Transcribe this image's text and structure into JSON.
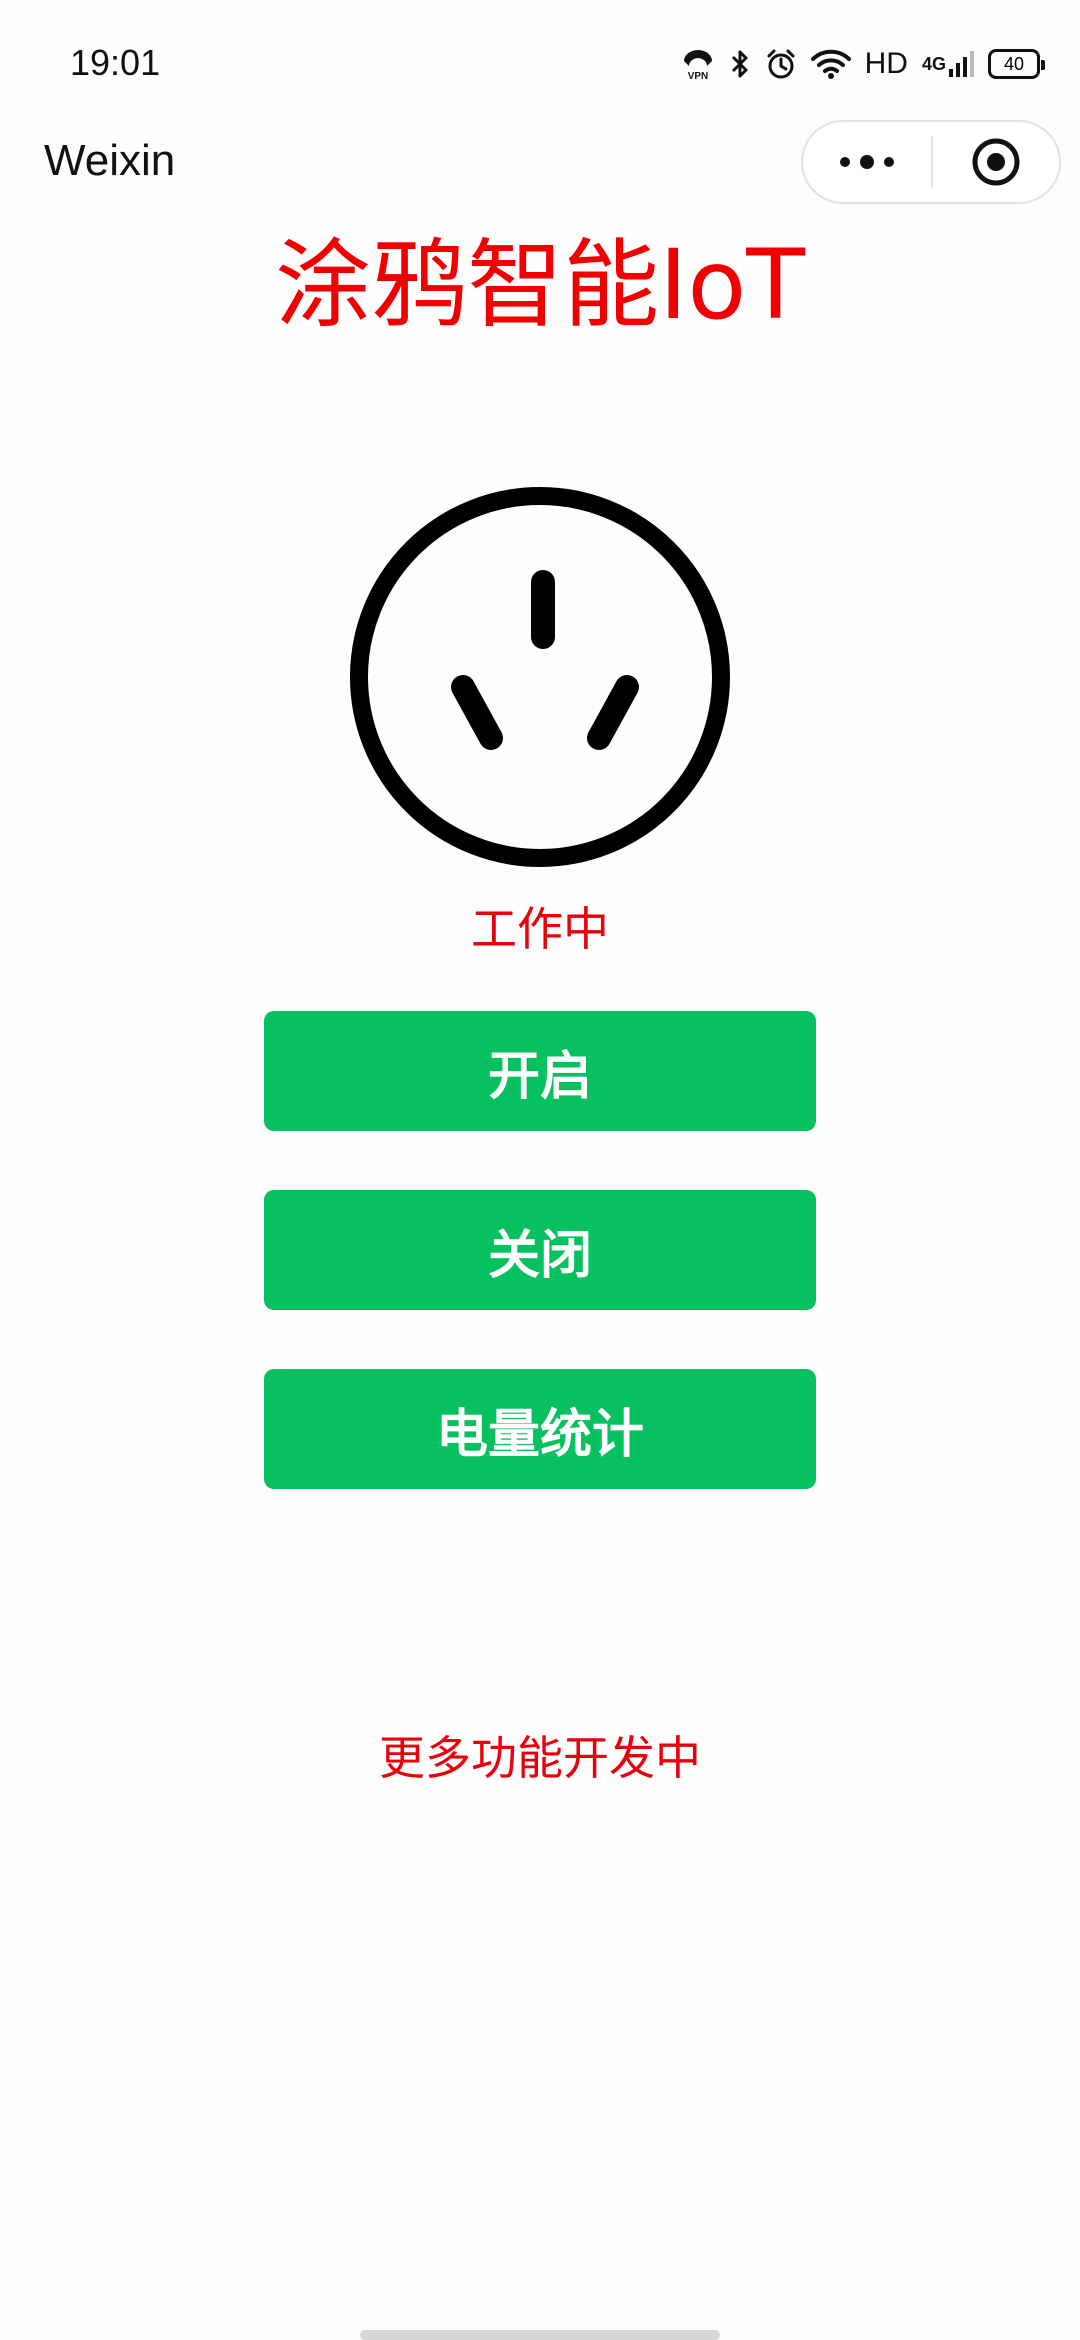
{
  "status_bar": {
    "time": "19:01",
    "icons": [
      "vpn-icon",
      "bluetooth-icon",
      "alarm-icon",
      "wifi-icon",
      "hd-label",
      "signal-4g-icon",
      "battery-icon"
    ],
    "hd_label": "HD",
    "network_label": "4G",
    "battery_level": "40"
  },
  "title_bar": {
    "app_title": "Weixin",
    "menu_icon": "more-dots-icon",
    "close_icon": "target-icon"
  },
  "main": {
    "title": "涂鸦智能IoT",
    "device_icon": "power-socket-icon",
    "status": "工作中",
    "buttons": {
      "open": "开启",
      "close": "关闭",
      "power_stats": "电量统计"
    },
    "footer_note": "更多功能开发中"
  },
  "colors": {
    "accent_red": "#e8000b",
    "button_green": "#07c160",
    "button_text": "#ffffff"
  }
}
